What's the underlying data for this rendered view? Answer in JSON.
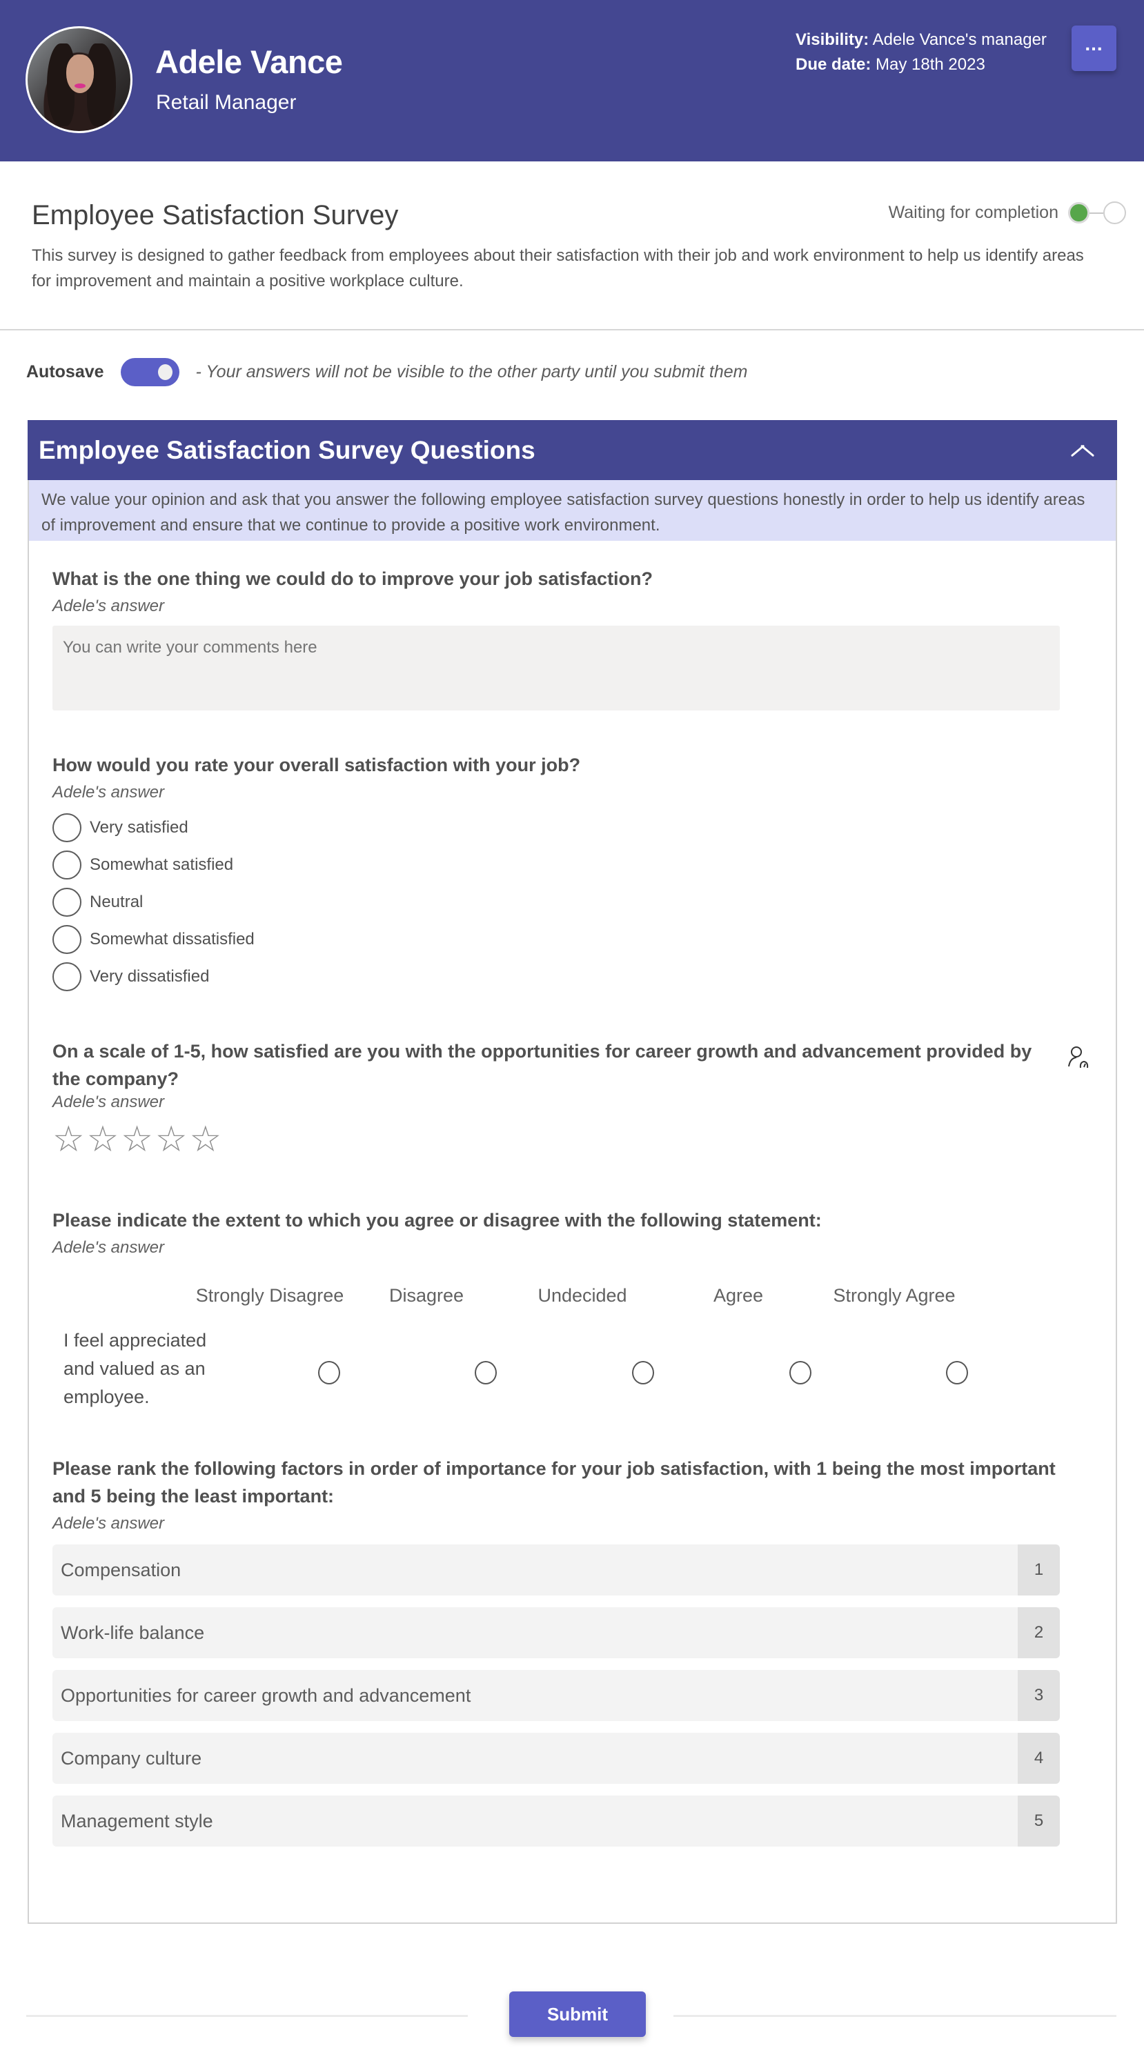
{
  "header": {
    "user_name": "Adele Vance",
    "user_role": "Retail Manager",
    "visibility_label": "Visibility:",
    "visibility_value": "Adele Vance's manager",
    "due_date_label": "Due date:",
    "due_date_value": "May 18th 2023",
    "more_button": "...",
    "avatar_icon": "user-photo"
  },
  "survey": {
    "title": "Employee Satisfaction Survey",
    "description": "This survey is designed to gather feedback from employees about their satisfaction with their job and work environment to help us identify areas for improvement and maintain a positive workplace culture.",
    "status_label": "Waiting for completion",
    "status_steps": [
      {
        "state": "done",
        "color": "#57a64a"
      },
      {
        "state": "pending",
        "color": "#ffffff"
      }
    ]
  },
  "autosave": {
    "label": "Autosave",
    "enabled": true,
    "note": "- Your answers will not be visible to the other party until you submit them"
  },
  "panel": {
    "title": "Employee Satisfaction Survey Questions",
    "collapse_icon": "chevron-up-icon",
    "intro": "We value your opinion and ask that you answer the following employee satisfaction survey questions honestly in order to help us identify areas of improvement and ensure that we continue to provide a positive work environment."
  },
  "questions": {
    "q1": {
      "title": "What is the one thing we could do to improve your job satisfaction?",
      "answer_label": "Adele's answer",
      "placeholder": "You can write your comments here",
      "value": ""
    },
    "q2": {
      "title": "How would you rate your overall satisfaction with your job?",
      "answer_label": "Adele's answer",
      "options": [
        "Very satisfied",
        "Somewhat satisfied",
        "Neutral",
        "Somewhat dissatisfied",
        "Very dissatisfied"
      ],
      "selected": null
    },
    "q3": {
      "title": "On a scale of 1-5, how satisfied are you with the opportunities for career growth and advancement provided by the company?",
      "answer_label": "Adele's answer",
      "max_rating": 5,
      "rating": 0,
      "star_glyph": "☆",
      "side_icon": "person-feedback-icon"
    },
    "q4": {
      "title": "Please indicate the extent to which you agree or disagree with the following statement:",
      "answer_label": "Adele's answer",
      "columns": [
        "Strongly Disagree",
        "Disagree",
        "Undecided",
        "Agree",
        "Strongly Agree"
      ],
      "statement": "I feel appreciated and valued as an employee.",
      "selected": null
    },
    "q5": {
      "title": "Please rank the following factors in order of importance for your job satisfaction, with 1 being the most important and 5 being the least important:",
      "answer_label": "Adele's answer",
      "items": [
        {
          "label": "Compensation",
          "rank": "1"
        },
        {
          "label": "Work-life balance",
          "rank": "2"
        },
        {
          "label": "Opportunities for career growth and advancement",
          "rank": "3"
        },
        {
          "label": "Company culture",
          "rank": "4"
        },
        {
          "label": "Management style",
          "rank": "5"
        }
      ]
    }
  },
  "footer": {
    "submit_label": "Submit"
  },
  "colors": {
    "brand": "#444791",
    "accent": "#5b5fc7",
    "intro_bg": "#dcdef8",
    "status_done": "#57a64a"
  }
}
